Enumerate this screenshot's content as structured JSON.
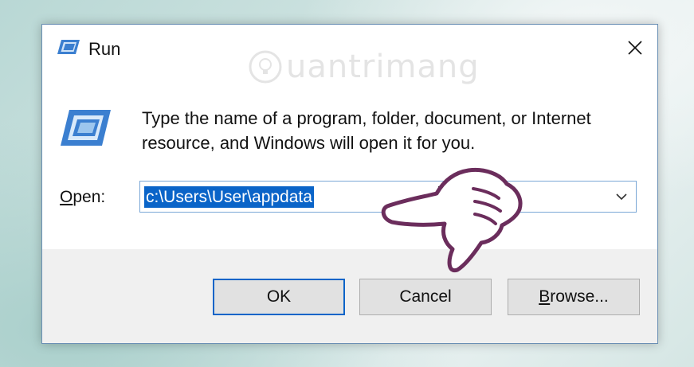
{
  "window": {
    "title": "Run",
    "close_symbol": "✕"
  },
  "watermark": {
    "text": "uantrimang",
    "icon": "lightbulb-logo"
  },
  "main": {
    "description": "Type the name of a program, folder, document, or Internet resource, and Windows will open it for you.",
    "open_label_mnemonic": "O",
    "open_label_rest": "pen:",
    "open_value": "c:\\Users\\User\\appdata"
  },
  "buttons": {
    "ok": "OK",
    "cancel": "Cancel",
    "browse_mnemonic": "B",
    "browse_rest": "rowse..."
  },
  "icons": {
    "run_small": "run-icon",
    "run_large": "run-icon",
    "close": "close-icon",
    "dropdown": "chevron-down-icon",
    "pointer": "pointing-hand-icon"
  },
  "colors": {
    "accent": "#0a64c8",
    "footer_bg": "#f0f0f0",
    "hand_stroke": "#6b2d5c"
  }
}
